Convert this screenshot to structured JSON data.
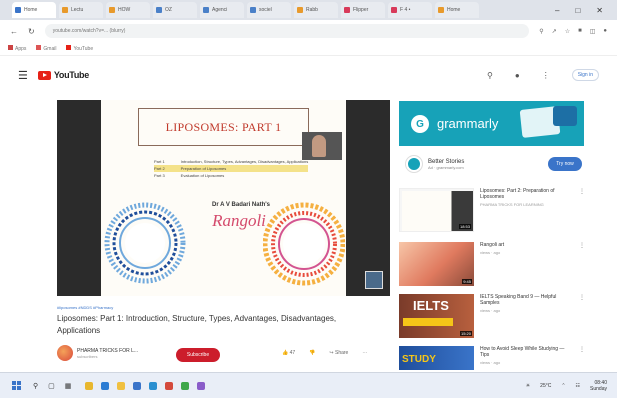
{
  "browser": {
    "tabs": [
      "Home",
      "Lectu",
      "HOW",
      "OZ",
      "Agenci",
      "sociel",
      "Rabb",
      "Flipper",
      "F 4 •",
      "Home"
    ],
    "address": "youtube.com/watch?v=... (blurry)",
    "bookmarks": [
      "Apps",
      "Gmail",
      "YouTube"
    ]
  },
  "youtube": {
    "logo_text": "YouTube",
    "sign_in": "Sign in"
  },
  "video": {
    "slide_title": "LIPOSOMES: PART 1",
    "parts": [
      {
        "label": "Part 1",
        "text": "Introduction, Structure, Types, Advantages, Disadvantages, Applications"
      },
      {
        "label": "Part 2",
        "text": "Preparation of Liposomes"
      },
      {
        "label": "Part 3",
        "text": "Evaluation of Liposomes"
      }
    ],
    "author_line": "Dr A V Badari Nath's",
    "rangoli_word": "Rangoli",
    "tags": "#liposomes #NDDS #Pharmacy",
    "title": "Liposomes: Part 1: Introduction, Structure, Types, Advantages, Disadvantages, Applications",
    "channel_name": "PHARMA TRICKS FOR L...",
    "channel_subs": "subscribers",
    "subscribe_label": "Subscribe",
    "like_label": "👍 47",
    "dislike_label": "👎",
    "share_label": "↪ Share",
    "more_label": "⋯"
  },
  "ad": {
    "brand": "grammarly",
    "advertiser": "Better Stories",
    "ad_label": "Ad · grammarly.com",
    "cta": "Try now"
  },
  "recommendations": [
    {
      "title": "Liposomes: Part 2: Preparation of Liposomes",
      "meta": "PHARMA TRICKS FOR LEARNING",
      "duration": "18:53"
    },
    {
      "title": "Rangoli art",
      "meta": "views · ago",
      "duration": "9:45"
    },
    {
      "title": "IELTS Speaking Band 9 — Helpful Samples",
      "meta": "views · ago",
      "duration": "15:20"
    },
    {
      "title": "How to Avoid Sleep While Studying — Tips",
      "meta": "views · ago",
      "duration": "10:05"
    }
  ],
  "rec_thumb_texts": [
    "IELTS",
    "STUDY"
  ],
  "taskbar": {
    "weather": "25°C",
    "time": "08:40",
    "date": "Sunday"
  },
  "colors": {
    "youtube_red": "#e62117",
    "grammarly_teal": "#17a2b8",
    "subscribe_red": "#cc1d2b",
    "title_red": "#c0392b"
  }
}
